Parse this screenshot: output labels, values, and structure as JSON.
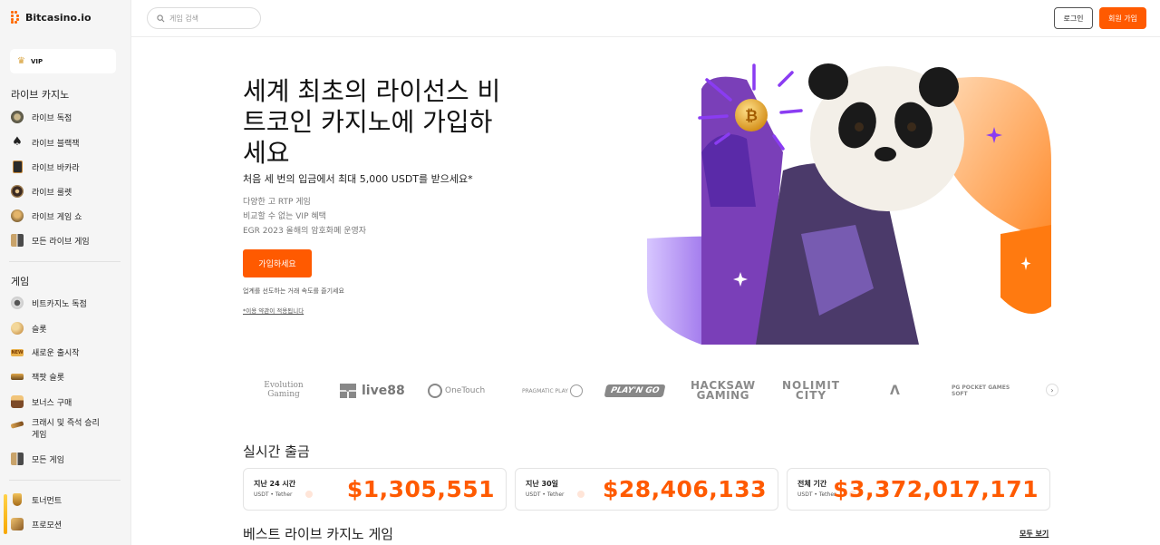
{
  "brand": {
    "name": "Bitcasino.io",
    "accent": "#ff5a00"
  },
  "sidebar": {
    "vip_label": "VIP",
    "live_section_title": "라이브 카지노",
    "live_items": [
      {
        "label": "라이브 독점",
        "icon": "poker-chip-icon"
      },
      {
        "label": "라이브 블랙잭",
        "icon": "spade-icon"
      },
      {
        "label": "라이브 바카라",
        "icon": "playing-card-icon"
      },
      {
        "label": "라이브 룰렛",
        "icon": "roulette-icon"
      },
      {
        "label": "라이브 게임 쇼",
        "icon": "game-show-icon"
      },
      {
        "label": "모든 라이브 게임",
        "icon": "grid-icon"
      }
    ],
    "games_section_title": "게임",
    "game_items": [
      {
        "label": "비트카지노 독점",
        "icon": "bitcasino-exclusive-icon"
      },
      {
        "label": "슬롯",
        "icon": "slot-icon"
      },
      {
        "label": "새로운 출시작",
        "icon": "new-badge-icon"
      },
      {
        "label": "잭팟 슬롯",
        "icon": "jackpot-icon"
      },
      {
        "label": "보너스 구매",
        "icon": "bonus-buy-icon"
      },
      {
        "label": "크래시 및 즉석 승리",
        "label2": "게임",
        "icon": "rocket-icon"
      },
      {
        "label": "모든 게임",
        "icon": "grid-icon"
      }
    ],
    "extra_items": [
      {
        "label": "토너먼트",
        "icon": "trophy-icon"
      },
      {
        "label": "프로모션",
        "icon": "gift-icon"
      }
    ]
  },
  "header": {
    "search_placeholder": "게임 검색",
    "login_label": "로그인",
    "signup_label": "회원 가입"
  },
  "hero": {
    "title_line1": "세계 최초의 라이선스 비",
    "title_line2": "트코인 카지노에 가입하",
    "title_line3": "세요",
    "subtitle": "처음 세 번의 입금에서 최대 5,000 USDT를 받으세요*",
    "features": [
      "다양한 고 RTP 게임",
      "비교할 수 없는 VIP 혜택",
      "EGR 2023 올해의 암호화폐 운영자"
    ],
    "cta_label": "가입하세요",
    "fine_print": "업계를 선도하는 거래 속도를 즐기세요",
    "terms_link": "*이용 약관이 적용됩니다"
  },
  "providers": [
    "Evolution Gaming",
    "live88",
    "OneTouch",
    "PRAGMATIC PLAY",
    "PLAY'N GO",
    "HACKSAW GAMING",
    "NOLIMIT CITY",
    "Λ",
    "PG POCKET GAMES SOFT"
  ],
  "payouts": {
    "title": "실시간 출금",
    "cards": [
      {
        "period": "지난 24 시간",
        "currency": "USDT • Tether",
        "amount": "$1,305,551"
      },
      {
        "period": "지난 30일",
        "currency": "USDT • Tether",
        "amount": "$28,406,133"
      },
      {
        "period": "전체 기간",
        "currency": "USDT • Tether",
        "amount": "$3,372,017,171"
      }
    ]
  },
  "best_live": {
    "title": "베스트 라이브 카지노 게임",
    "see_all": "모두 보기"
  }
}
